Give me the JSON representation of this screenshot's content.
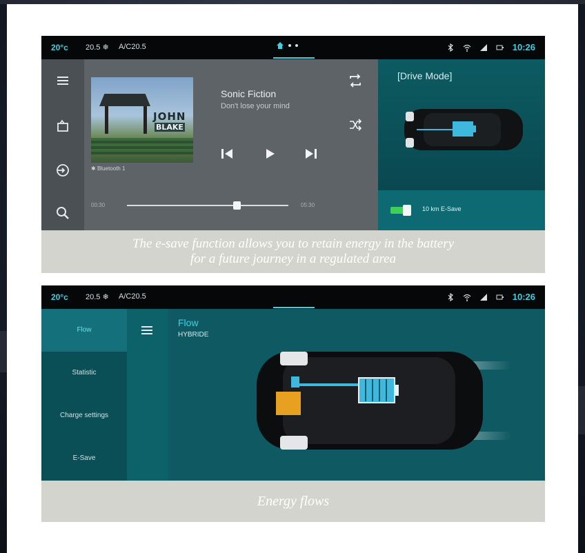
{
  "status": {
    "temp": "20°c",
    "fan": "20.5 ❄",
    "ac": "A/C20.5",
    "time": "10:26",
    "time2": "10:26"
  },
  "player": {
    "title": "Sonic Fiction",
    "subtitle": "Don't lose your mind",
    "album_word1": "JOHN",
    "album_word2": "BLAKE",
    "bluetooth_source": "Bluetooth 1",
    "time_start": "00:30",
    "time_end": "05:30",
    "progress": 0.68
  },
  "drive": {
    "title": "[Drive Mode]",
    "esave_label": "10 km E-Save"
  },
  "captions": {
    "top_line1": "The e-save function allows you to retain energy in the battery",
    "top_line2": "for a future journey in a regulated area",
    "bottom": "Energy flows"
  },
  "energy": {
    "menu": [
      "Flow",
      "Statistic",
      "Charge settings",
      "E-Save"
    ],
    "flow_title": "Flow",
    "flow_mode": "HYBRIDE"
  },
  "icons": {
    "menu": "hamburger-icon",
    "media": "media-source-icon",
    "input": "input-icon",
    "search": "search-icon",
    "repeat": "repeat-icon",
    "shuffle": "shuffle-icon"
  },
  "colors": {
    "accent": "#3fd0e0",
    "toggle_on": "#3fd05a",
    "battery": "#3fb8e0",
    "engine": "#e8a020"
  }
}
